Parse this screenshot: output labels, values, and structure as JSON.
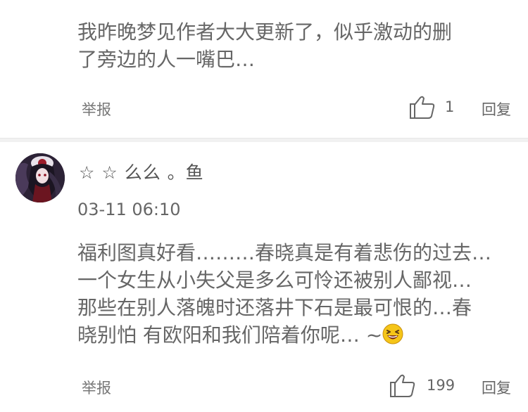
{
  "comments": [
    {
      "text_lines": [
        "我昨晚梦见作者大大更新了，似乎激动的删",
        "了旁边的人一嘴巴…"
      ],
      "report_label": "举报",
      "like_count": "1",
      "reply_label": "回复"
    },
    {
      "username": "☆ ☆ 么么 。鱼",
      "timestamp": "03-11 06:10",
      "text_lines": [
        "福利图真好看………春晓真是有着悲伤的过去…",
        "一个女生从小失父是多么可怜还被别人鄙视…",
        "那些在别人落魄时还落井下石是最可恨的…春",
        "晓别怕 有欧阳和我们陪着你呢… ~"
      ],
      "report_label": "举报",
      "like_count": "199",
      "reply_label": "回复"
    }
  ],
  "icons": {
    "like": "thumbs-up-outline-icon",
    "emoji": "laughing-face-emoji-icon",
    "avatar": "user-avatar-image"
  },
  "colors": {
    "text": "#666666",
    "meta": "#777777",
    "divider": "#f1f1f1",
    "emoji_face": "#f5c518"
  }
}
